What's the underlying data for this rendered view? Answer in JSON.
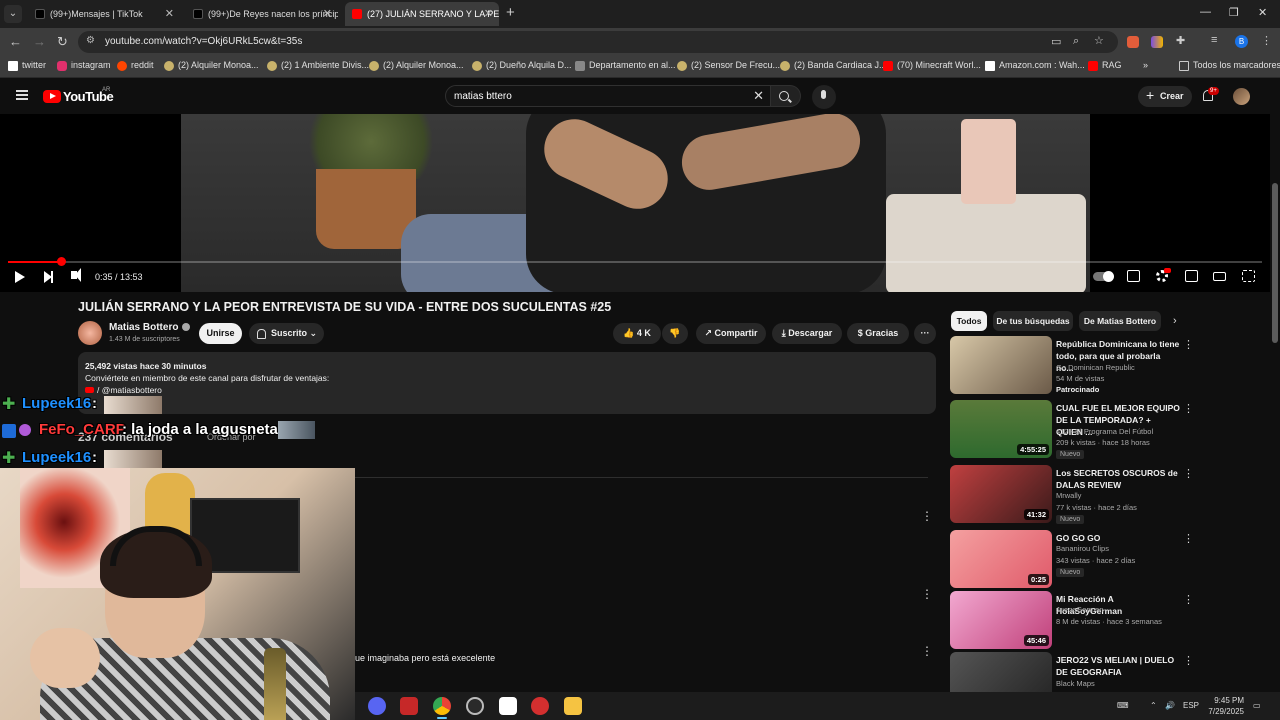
{
  "browser": {
    "tabs": [
      {
        "title": "(99+)Mensajes | TikTok",
        "color": "#000000"
      },
      {
        "title": "(99+)De Reyes nacen los príncip",
        "color": "#000000"
      },
      {
        "title": "(27) JULIÁN SERRANO Y LA PEO",
        "color": "#ff0000"
      }
    ],
    "url": "youtube.com/watch?v=Okj6URkL5cw&t=35s",
    "bookmarks": [
      {
        "label": "twitter",
        "color": "#ffffff"
      },
      {
        "label": "instagram",
        "color": "#e1306c"
      },
      {
        "label": "reddit",
        "color": "#ff4500"
      },
      {
        "label": "(2) Alquiler Monoa...",
        "color": "#c8b26b"
      },
      {
        "label": "(2) 1 Ambiente Divis...",
        "color": "#c8b26b"
      },
      {
        "label": "(2) Alquiler Monoa...",
        "color": "#c8b26b"
      },
      {
        "label": "(2) Dueño Alquila D...",
        "color": "#c8b26b"
      },
      {
        "label": "Departamento en al...",
        "color": "#888888"
      },
      {
        "label": "(2) Sensor De Frecu...",
        "color": "#c8b26b"
      },
      {
        "label": "(2) Banda Cardiaca J...",
        "color": "#c8b26b"
      },
      {
        "label": "(70) Minecraft Worl...",
        "color": "#ff0000"
      },
      {
        "label": "Amazon.com : Wah...",
        "color": "#ffffff"
      },
      {
        "label": "RAG",
        "color": "#ff0000"
      }
    ],
    "bookmarks_overflow": "»",
    "all_bookmarks": "Todos los marcadores",
    "profile_initial": "B"
  },
  "youtube": {
    "logo_text": "YouTube",
    "country": "AR",
    "search_value": "matias bttero",
    "create_label": "Crear",
    "notif_badge": "9+"
  },
  "video": {
    "time": "0:35 / 13:53",
    "progress_fraction": 0.042,
    "title": "JULIÁN SERRANO Y LA PEOR ENTREVISTA DE SU VIDA - ENTRE DOS SUCULENTAS #25",
    "channel": "Matias Bottero",
    "subscribers": "1.43 M de suscriptores",
    "join_label": "Unirse",
    "subscribed_label": "Suscrito",
    "likes": "4 K",
    "share_label": "Compartir",
    "download_label": "Descargar",
    "thanks_label": "Gracias",
    "more_label": "···",
    "desc_views": "25,492 vistas  hace 30 minutos",
    "desc_member": "Conviértete en miembro de este canal para disfrutar de ventajas:",
    "desc_handle": "/ @matiasbottero",
    "comments_count": "237 comentarios",
    "sort_label": "Ordenar por",
    "comment_snippet": "ue imaginaba pero está execelente"
  },
  "chat": [
    {
      "user": "Lupeek16",
      "msg": ":",
      "color": "#1e90ff"
    },
    {
      "user": "FeFo_CARP",
      "msg": ": la joda a la agusneta",
      "color": "#ff3a3a"
    },
    {
      "user": "Lupeek16",
      "msg": ":",
      "color": "#1e90ff"
    }
  ],
  "sidebar": {
    "chips": [
      "Todos",
      "De tus búsquedas",
      "De Matias Bottero"
    ],
    "recommendations": [
      {
        "title": "República Dominicana lo tiene todo, para que al probarla no...",
        "channel": "Go Dominican Republic",
        "meta": "54 M de vistas",
        "tag": "",
        "sponsored": "Patrocinado",
        "duration": "",
        "thumb": "#6b5a48"
      },
      {
        "title": "CUAL FUE EL MEJOR EQUIPO DE LA TEMPORADA? + QUIEN ...",
        "channel": "412 - El Programa Del Fútbol",
        "meta": "209 k vistas · hace 18 horas",
        "tag": "Nuevo",
        "sponsored": "",
        "duration": "4:55:25",
        "thumb": "#2e6a2e"
      },
      {
        "title": "Los SECRETOS OSCUROS de DALAS REVIEW",
        "channel": "Mrwally",
        "meta": "77 k vistas · hace 2 días",
        "tag": "Nuevo",
        "sponsored": "",
        "duration": "41:32",
        "thumb": "#7a2a2a"
      },
      {
        "title": "GO GO GO",
        "channel": "Bananirou Clips",
        "meta": "343 vistas · hace 2 días",
        "tag": "Nuevo",
        "sponsored": "",
        "duration": "0:25",
        "thumb": "#e8707a"
      },
      {
        "title": "Mi Reacción A HolaSoyGerman",
        "channel": "JuegaGerman",
        "meta": "8 M de vistas · hace 3 semanas",
        "tag": "",
        "sponsored": "",
        "duration": "45:46",
        "thumb": "#e06aa8"
      },
      {
        "title": "JERO22 VS MELIAN | DUELO DE GEOGRAFIA",
        "channel": "Black Maps",
        "meta": "",
        "tag": "",
        "sponsored": "",
        "duration": "",
        "thumb": "#3a3a3a"
      }
    ]
  },
  "taskbar": {
    "lang": "ESP",
    "time": "9:45 PM",
    "date": "7/29/2025"
  }
}
